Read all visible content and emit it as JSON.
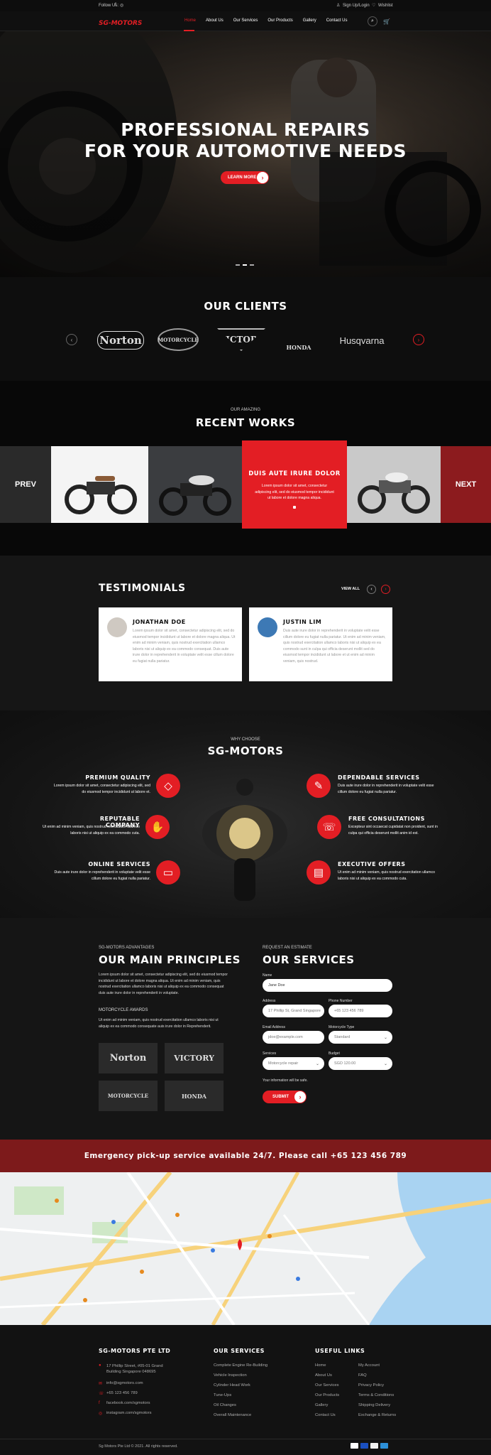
{
  "topbar": {
    "follow": "Follow Us:",
    "signup": "Sign Up/Login",
    "wishlist": "Wishlist"
  },
  "nav": {
    "logo": "SG-MOTORS",
    "items": [
      "Home",
      "About Us",
      "Our Services",
      "Our Products",
      "Gallery",
      "Contact Us"
    ]
  },
  "hero": {
    "line1": "PROFESSIONAL REPAIRS",
    "line2": "FOR YOUR AUTOMOTIVE NEEDS",
    "button": "LEARN MORE"
  },
  "clients": {
    "title": "OUR CLIENTS",
    "logos": [
      "Norton",
      "MOTORCYCLE",
      "VICTORY",
      "HONDA",
      "Husqvarna"
    ]
  },
  "works": {
    "subtitle": "OUR AMAZING",
    "title": "RECENT WORKS",
    "prev": "PREV",
    "next": "NEXT",
    "feature_title": "DUIS AUTE IRURE DOLOR",
    "feature_text": "Lorem ipsum dolor sit amet, consectetur adipiscing elit, sed do eiusmod tempor incididunt ut labore et dolore magna aliqua."
  },
  "testimonials": {
    "title": "TESTIMONIALS",
    "view_all": "VIEW ALL",
    "items": [
      {
        "name": "JONATHAN DOE",
        "text": "Lorem ipsum dolor sit amet, consectetur adipiscing elit, sed do eiusmod tempor incididunt ut labore et dolore magna aliqua. Ut enim ad minim veniam, quis nostrud exercitation ullamco laboris nisi ut aliquip ex ea commodo consequat. Duis aute irure dolor in reprehenderit in voluptate velit esse cillum dolore eu fugiat nulla pariatur."
      },
      {
        "name": "JUSTIN LIM",
        "text": "Duis aute irure dolor in reprehenderit in voluptate velit esse cillum dolore eu fugiat nulla pariatur. Ut enim ad minim veniam, quis nostrud exercitation ullamco laboris nisi ut aliquip ex ea commodo sunt in culpa qui officia deserunt mollit sed do eiusmod tempor incididunt ut labore et ut enim ad minim veniam, quis nostrud."
      }
    ]
  },
  "why": {
    "subtitle": "WHY CHOOSE",
    "title": "SG-MOTORS",
    "left": [
      {
        "title": "PREMIUM QUALITY",
        "text": "Lorem ipsum dolor sit amet, consectetur adipiscing elit, sed do eiusmod tempor incididunt ut labore et."
      },
      {
        "title": "REPUTABLE COMPANY",
        "text": "Ut enim ad minim veniam, quis nostrud exercitation ullamco laboris nisi ut aliquip ex ea commodo cuta."
      },
      {
        "title": "ONLINE SERVICES",
        "text": "Duis aute irure dolor in reprehenderit in voluptate velit esse cillum dolore eu fugiat nulla pariatur."
      }
    ],
    "right": [
      {
        "title": "DEPENDABLE  SERVICES",
        "text": "Duis aute irure dolor in reprehenderit in voluptate velit esse cillum dolore eu fugiat nulla pariatur."
      },
      {
        "title": "FREE CONSULTATIONS",
        "text": "Excepteur sint occaecat cupidatat non proident, sunt in culpa qui officia deserunt mollit anim id est."
      },
      {
        "title": "EXECUTIVE OFFERS",
        "text": "Ut enim ad minim veniam, quis nostrud exercitation ullamco laboris nisi ut aliquip ex ea commodo cuta."
      }
    ]
  },
  "principles": {
    "subtitle": "SG-MOTORS ADVANTAGES",
    "title": "OUR MAIN PRINCIPLES",
    "text": "Lorem ipsum dolor sit amet, consectetur adipiscing elit, sed do eiusmod tempor incididunt ut labore et dolore magna aliqua. Ut enim ad minim veniam, quis nostrud exercitation ullamco laboris nisi ut aliquip ex ea commodo consequat duis aute irure dolor in reprehenderit in voluptate.",
    "awards_title": "MOTORCYCLE AWARDS",
    "awards_text": "Ut enim ad minim veniam, quis nostrud exercitation ullamco laboris nisi ut aliquip ex ea commodo consequate auis irure dolor in Reprehenderit.",
    "awards": [
      "Norton",
      "VICTORY",
      "MOTORCYCLE",
      "HONDA"
    ]
  },
  "services_form": {
    "subtitle": "REQUEST AN ESTIMATE",
    "title": "OUR SERVICES",
    "name_label": "Name",
    "name_value": "Jane Doe",
    "address_label": "Address",
    "address_value": "17 Phillip St, Grand Singapore",
    "phone_label": "Phone Number",
    "phone_value": "+65 123 456 789",
    "email_label": "Email Address",
    "email_value": "jdoe@example.com",
    "moto_label": "Motorcycle Type",
    "moto_value": "Standard",
    "services_label": "Services",
    "services_value": "Motorcycle repair",
    "budget_label": "Budget",
    "budget_value": "SGD 120.00",
    "note": "Your information will be safe.",
    "submit": "SUBMIT"
  },
  "emergency": "Emergency pick-up service available 24/7. Please call +65 123 456 789",
  "footer": {
    "company": "SG-MOTORS PTE LTD",
    "address": "17 Phillip Street, #05-01 Grand Building Singapore 048695",
    "email": "info@sgmotors.com",
    "phone": "+65 123 456 789",
    "facebook": "facebook.com/sgmotors",
    "instagram": "instagram.com/sgmotors",
    "services_title": "OUR SERVICES",
    "services": [
      "Complete Engine Re-Building",
      "Vehicle Inspection",
      "Cylinder Head Work",
      "Tune-Ups",
      "Oil Changes",
      "Overall Maintenance"
    ],
    "links_title": "USEFUL LINKS",
    "links_a": [
      "Home",
      "About Us",
      "Our Services",
      "Our Products",
      "Gallery",
      "Contact Us"
    ],
    "links_b": [
      "My Account",
      "FAQ",
      "Privacy Policy",
      "Terms & Conditions",
      "Shipping Delivery",
      "Exchange & Returns"
    ],
    "copyright": "Sg Motors Pte Ltd © 2021. All rights reserved."
  },
  "colors": {
    "accent": "#e31e24",
    "dark": "#141414",
    "emergency_bg": "#7d1a1b"
  }
}
